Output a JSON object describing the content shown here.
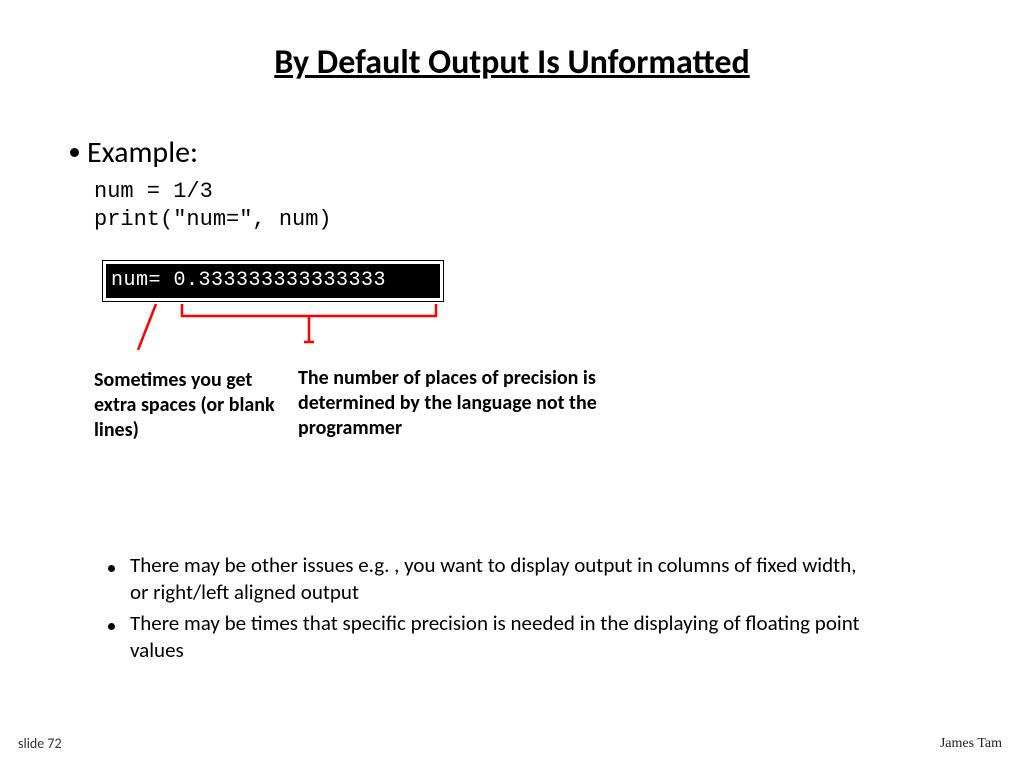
{
  "title": "By Default Output Is Unformatted",
  "example_label": "Example:",
  "code": "num = 1/3\nprint(\"num=\", num)",
  "console_output": "num= 0.333333333333333",
  "callouts": {
    "left": "Sometimes you get extra spaces (or blank lines)",
    "right": "The number of places of precision is determined by the language not the programmer"
  },
  "sub_bullets": [
    "There may be other issues e.g. , you want to display output in columns of fixed width, or right/left aligned output",
    "There may be times that specific precision is needed in the displaying of floating point values"
  ],
  "footer": {
    "slide_label": "slide 72",
    "author": "James Tam"
  },
  "colors": {
    "annotation_red": "#ff0000"
  }
}
